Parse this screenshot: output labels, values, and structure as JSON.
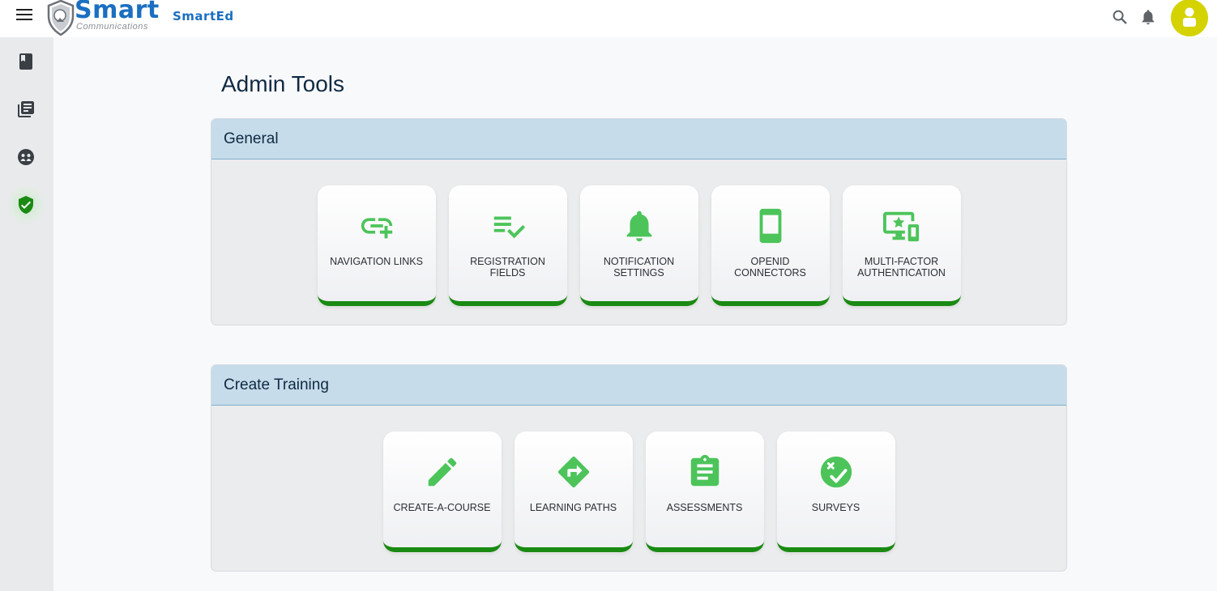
{
  "header": {
    "brand_name": "Smart",
    "brand_sub": "Communications",
    "product_name": "SmartEd",
    "icons": [
      "menu-icon",
      "search-icon",
      "bell-icon",
      "user-icon"
    ],
    "avatar_color": "#d4d300"
  },
  "sidebar": {
    "items": [
      {
        "icon": "book-icon"
      },
      {
        "icon": "library-icon"
      },
      {
        "icon": "people-icon"
      },
      {
        "icon": "shield-check-icon",
        "active": true
      }
    ]
  },
  "page": {
    "title": "Admin Tools"
  },
  "sections": [
    {
      "title": "General",
      "tiles": [
        {
          "label": "NAVIGATION LINKS",
          "icon": "add-link-icon"
        },
        {
          "label": "REGISTRATION FIELDS",
          "icon": "checklist-icon"
        },
        {
          "label": "NOTIFICATION SETTINGS",
          "icon": "bell-icon"
        },
        {
          "label": "OPENID CONNECTORS",
          "icon": "phone-device-icon"
        },
        {
          "label": "MULTI-FACTOR AUTHENTICATION",
          "icon": "devices-star-icon"
        }
      ]
    },
    {
      "title": "Create Training",
      "tiles": [
        {
          "label": "CREATE-A-COURSE",
          "icon": "pencil-icon"
        },
        {
          "label": "LEARNING PATHS",
          "icon": "directions-icon"
        },
        {
          "label": "ASSESSMENTS",
          "icon": "clipboard-icon"
        },
        {
          "label": "SURVEYS",
          "icon": "check-x-circle-icon"
        }
      ]
    }
  ],
  "colors": {
    "accent_green": "#1a8a12",
    "icon_green": "#4cc45a",
    "brand_blue": "#1b6fc0",
    "section_header": "#c6dcea"
  }
}
